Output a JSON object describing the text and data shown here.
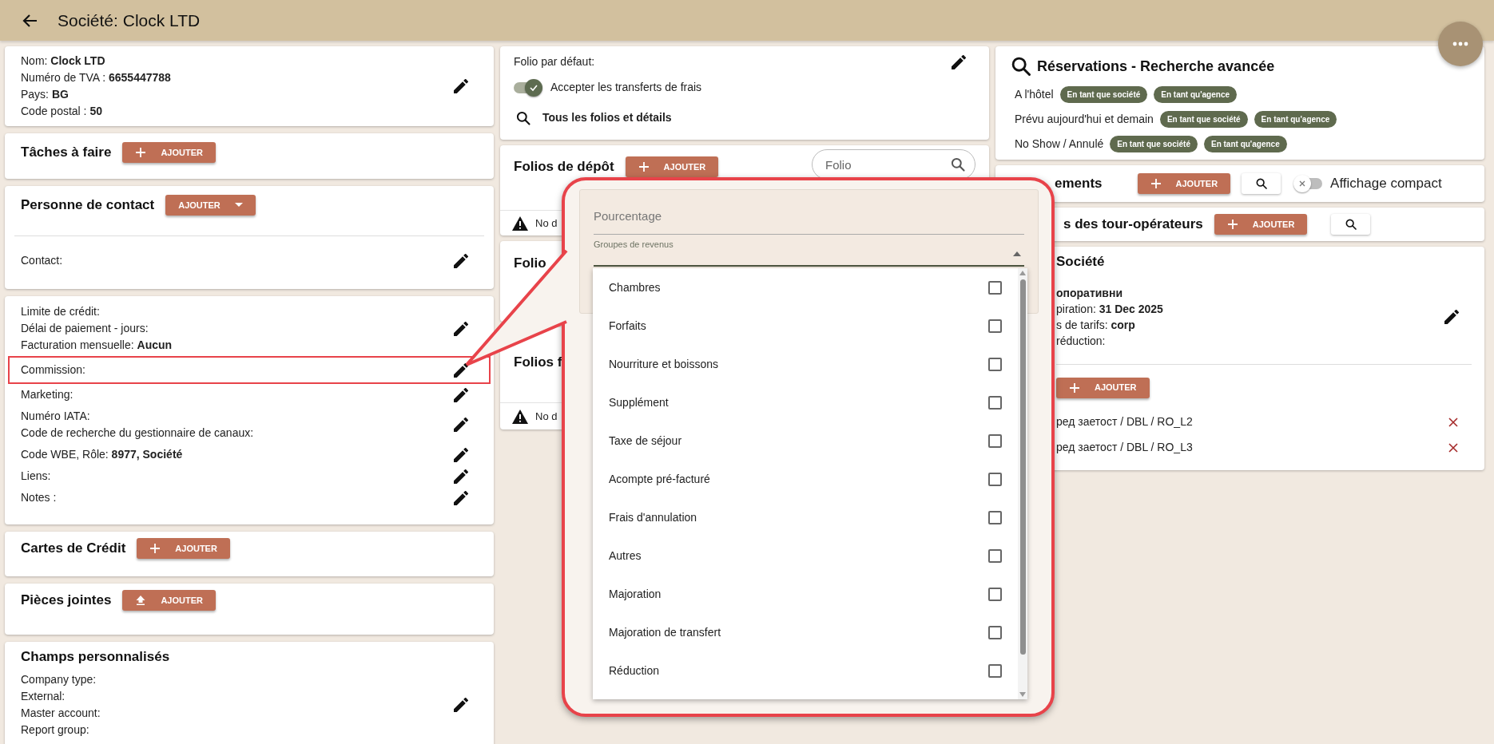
{
  "header": {
    "title": "Société: Clock LTD"
  },
  "left": {
    "company": {
      "lines": [
        "Nom: **Clock LTD**",
        "Numéro de TVA : **6655447788**",
        "Pays: **BG**",
        "Code postal : **50**"
      ]
    },
    "tasks": {
      "title": "Tâches à faire",
      "button": {
        "label": "AJOUTER"
      }
    },
    "contact": {
      "title": "Personne de contact",
      "button": {
        "label": "AJOUTER"
      },
      "field": "Contact:"
    },
    "billing": {
      "groups": [
        {
          "lines": [
            "Limite de crédit:",
            "Délai de paiement - jours:",
            "Facturation mensuelle: **Aucun**"
          ],
          "highlighted": false
        },
        {
          "lines": [
            "Commission:"
          ],
          "highlighted": true
        },
        {
          "lines": [
            "Marketing:"
          ],
          "highlighted": false
        },
        {
          "lines": [
            "Numéro IATA:",
            "Code de recherche du gestionnaire de canaux:"
          ],
          "highlighted": false
        },
        {
          "lines": [
            "Code WBE, Rôle: **8977, Société**"
          ],
          "highlighted": false
        },
        {
          "lines": [
            "Liens:"
          ],
          "highlighted": false
        },
        {
          "lines": [
            "Notes :"
          ],
          "highlighted": false
        }
      ]
    },
    "cards": {
      "title": "Cartes de Crédit",
      "button": {
        "label": "AJOUTER"
      }
    },
    "attachments": {
      "title": "Pièces jointes",
      "button": {
        "label": "AJOUTER"
      }
    },
    "custom": {
      "title": "Champs personnalisés",
      "lines": [
        "Company type:",
        "External:",
        "Master account:",
        "Report group:"
      ]
    }
  },
  "middle": {
    "folio_settings": {
      "default_label": "Folio par défaut:",
      "accept": {
        "label": "Accepter les transferts de frais",
        "on": true
      },
      "link": "Tous les folios et détails"
    },
    "deposit": {
      "title": "Folios de dépôt",
      "button": {
        "label": "AJOUTER"
      },
      "search": {
        "placeholder": "Folio"
      },
      "warning": "No d"
    },
    "folios": {
      "title": "Folio"
    },
    "folios_f": {
      "title": "Folios f",
      "warning": "No d"
    }
  },
  "right": {
    "reservations": {
      "title": "Réservations - Recherche avancée",
      "rows": [
        {
          "label": "A l'hôtel",
          "chips": [
            "En tant que société",
            "En tant qu'agence"
          ]
        },
        {
          "label": "Prévu aujourd'hui et demain",
          "chips": [
            "En tant que société",
            "En tant qu'agence"
          ]
        },
        {
          "label": "No Show / Annulé",
          "chips": [
            "En tant que société",
            "En tant qu'agence"
          ]
        }
      ]
    },
    "accommodations": {
      "title": "ements",
      "button": {
        "label": "AJOUTER"
      },
      "compact": {
        "label": "Affichage compact",
        "on": false
      }
    },
    "tour_operators": {
      "title": "s des tour-opérateurs",
      "button": {
        "label": "AJOUTER"
      }
    },
    "company_rates": {
      "title": "Société",
      "name": "опоративни",
      "lines": [
        "piration: **31 Dec 2025**",
        "s de tarifs: **corp**",
        "réduction:"
      ],
      "button": {
        "label": "AJOUTER"
      },
      "items": [
        "ред заетост / DBL / RO_L2",
        "ред заетост / DBL / RO_L3"
      ]
    }
  },
  "callout": {
    "field": {
      "placeholder": "Pourcentage"
    },
    "select_label": "Groupes de revenus",
    "options": [
      {
        "label": "Chambres",
        "checked": false
      },
      {
        "label": "Forfaits",
        "checked": false
      },
      {
        "label": "Nourriture et boissons",
        "checked": false
      },
      {
        "label": "Supplément",
        "checked": false
      },
      {
        "label": "Taxe de séjour",
        "checked": false
      },
      {
        "label": "Acompte pré-facturé",
        "checked": false
      },
      {
        "label": "Frais d'annulation",
        "checked": false
      },
      {
        "label": "Autres",
        "checked": false
      },
      {
        "label": "Majoration",
        "checked": false
      },
      {
        "label": "Majoration de transfert",
        "checked": false
      },
      {
        "label": "Réduction",
        "checked": false
      }
    ]
  }
}
